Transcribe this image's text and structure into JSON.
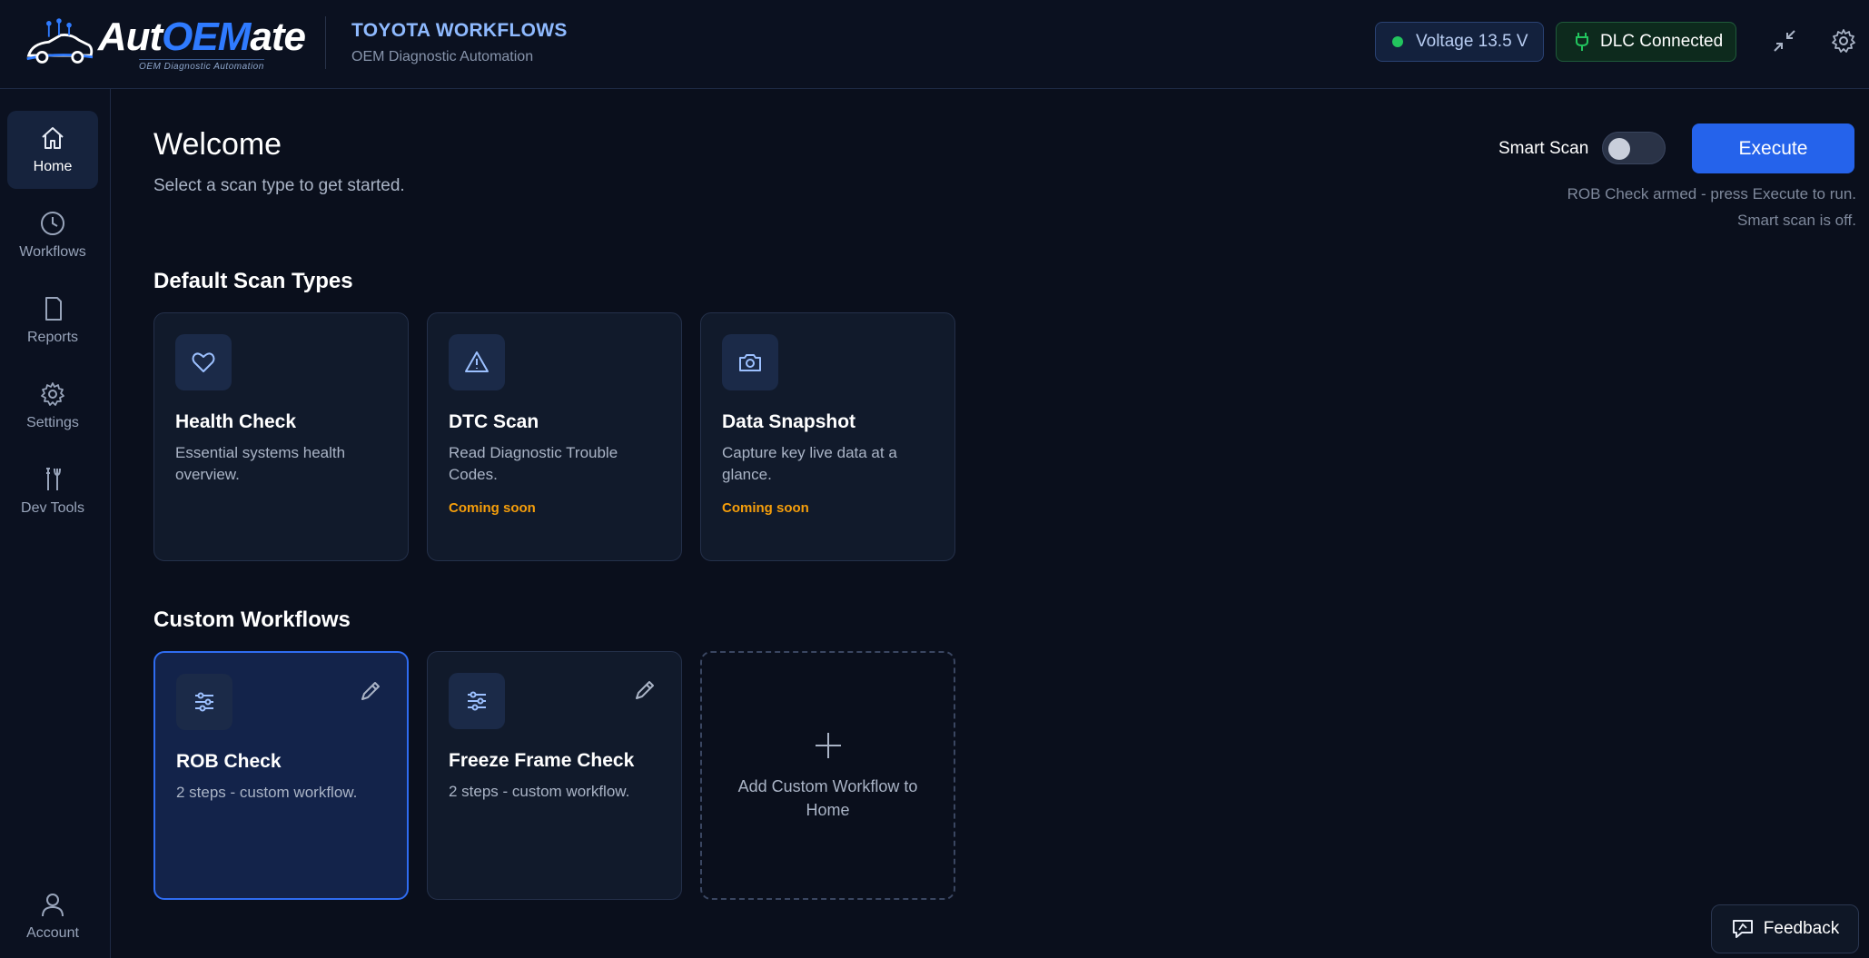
{
  "app": {
    "logo_main": "Aut",
    "logo_accent": "OEM",
    "logo_end": "ate",
    "logo_tagline": "OEM Diagnostic Automation",
    "title": "TOYOTA WORKFLOWS",
    "subtitle": "OEM Diagnostic Automation"
  },
  "status": {
    "voltage": "Voltage 13.5 V",
    "dlc": "DLC Connected"
  },
  "sidebar": {
    "items": [
      {
        "label": "Home",
        "icon": "home-icon",
        "active": true
      },
      {
        "label": "Workflows",
        "icon": "clock-icon"
      },
      {
        "label": "Reports",
        "icon": "document-icon"
      },
      {
        "label": "Settings",
        "icon": "gear-icon"
      },
      {
        "label": "Dev Tools",
        "icon": "tools-icon"
      }
    ],
    "account": "Account"
  },
  "main": {
    "welcome": "Welcome",
    "welcome_sub": "Select a scan type to get started.",
    "smart_scan_label": "Smart Scan",
    "smart_scan_on": false,
    "execute_label": "Execute",
    "status_line1": "ROB Check armed - press Execute to run.",
    "status_line2": "Smart scan is off."
  },
  "default_scans": {
    "title": "Default Scan Types",
    "cards": [
      {
        "title": "Health Check",
        "desc": "Essential systems health overview.",
        "badge": "",
        "icon": "heart-icon"
      },
      {
        "title": "DTC Scan",
        "desc": "Read Diagnostic Trouble Codes.",
        "badge": "Coming soon",
        "icon": "warning-icon"
      },
      {
        "title": "Data Snapshot",
        "desc": "Capture key live data at a glance.",
        "badge": "Coming soon",
        "icon": "camera-icon"
      }
    ]
  },
  "custom_workflows": {
    "title": "Custom Workflows",
    "cards": [
      {
        "title": "ROB Check",
        "desc": "2 steps - custom workflow.",
        "selected": true,
        "icon": "sliders-icon"
      },
      {
        "title": "Freeze Frame Check",
        "desc": "2 steps - custom workflow.",
        "selected": false,
        "icon": "sliders-icon"
      }
    ],
    "add_label": "Add Custom Workflow to Home"
  },
  "feedback_label": "Feedback",
  "colors": {
    "accent": "#2563eb",
    "status_ok": "#22c55e",
    "badge": "#f59e0b",
    "background": "#0a0f1c"
  }
}
